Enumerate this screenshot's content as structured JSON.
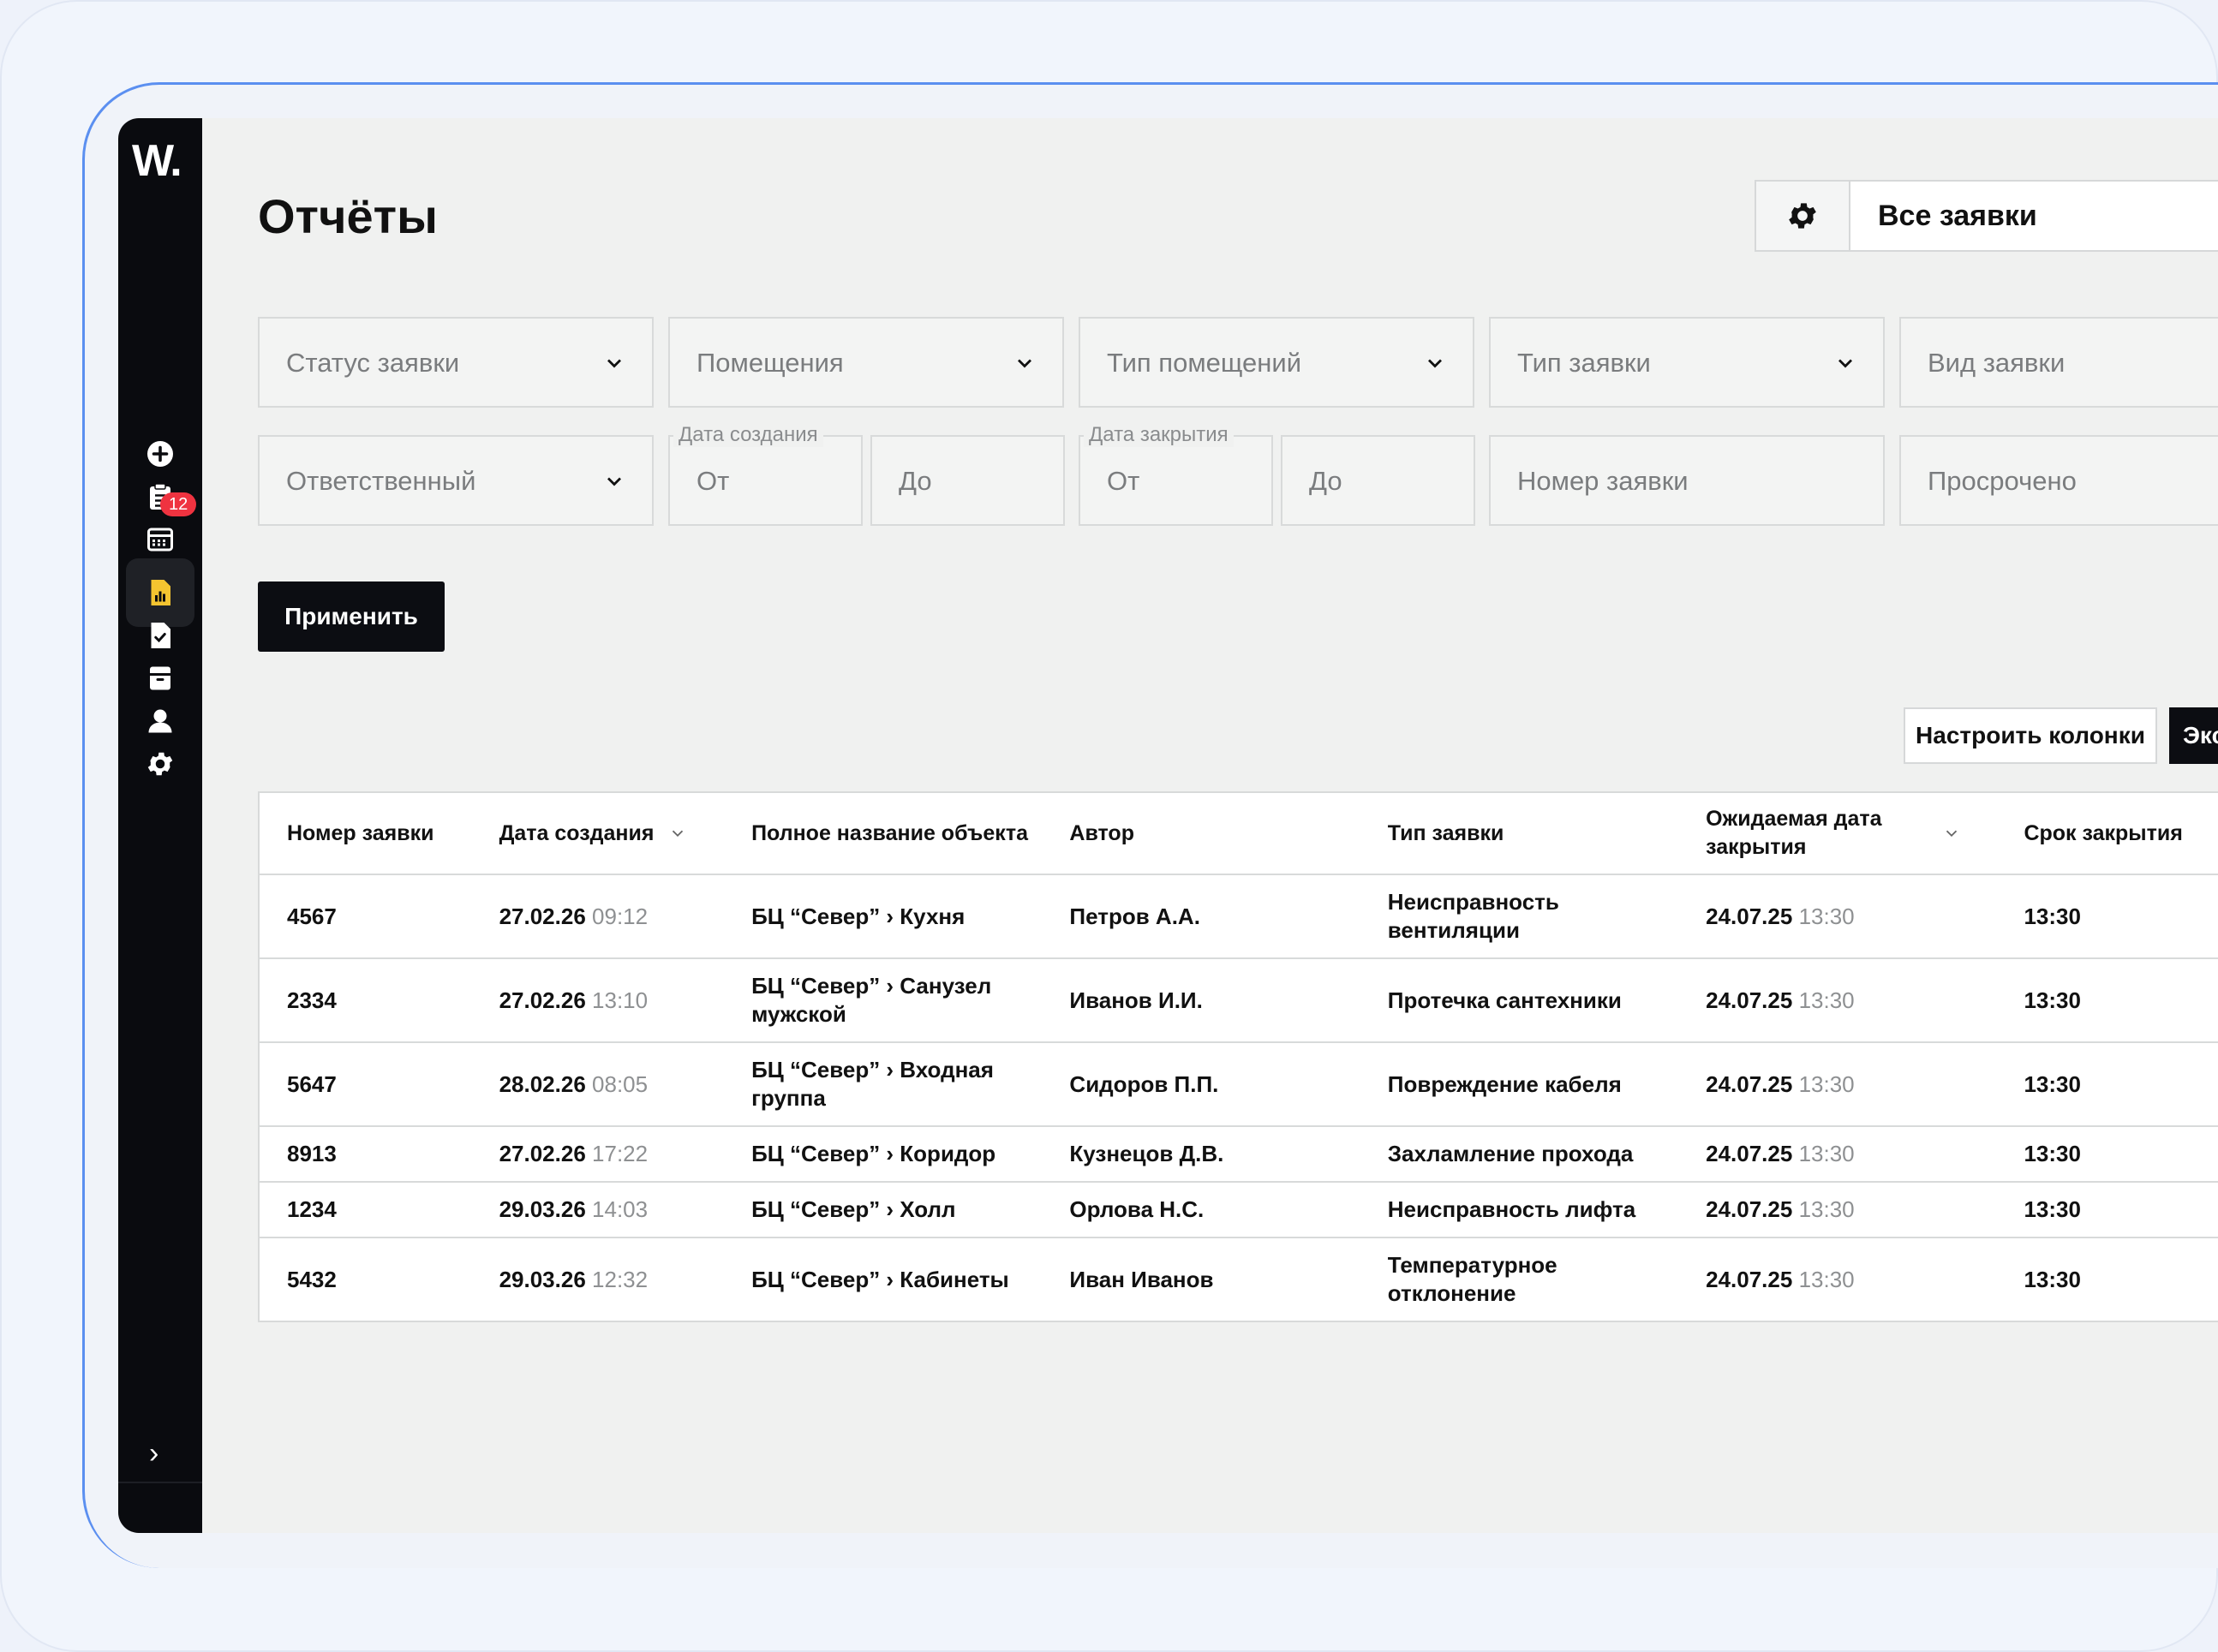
{
  "app": {
    "logo": "W."
  },
  "sidebar": {
    "items": [
      {
        "icon": "plus-circle-icon"
      },
      {
        "icon": "clipboard-icon",
        "badge": "12"
      },
      {
        "icon": "calendar-icon"
      },
      {
        "icon": "report-chart-icon",
        "active": true
      },
      {
        "icon": "file-check-icon"
      },
      {
        "icon": "archive-icon"
      },
      {
        "icon": "user-icon"
      },
      {
        "icon": "gear-icon"
      }
    ],
    "expand_icon": "›"
  },
  "header": {
    "title": "Отчёты",
    "view_label": "Все заявки"
  },
  "filters": {
    "status": "Статус заявки",
    "rooms": "Помещения",
    "room_type": "Тип помещений",
    "request_type": "Тип заявки",
    "request_kind": "Вид заявки",
    "responsible": "Ответственный",
    "created_legend": "Дата создания",
    "created_from": "От",
    "created_to": "До",
    "closed_legend": "Дата закрытия",
    "closed_from": "От",
    "closed_to": "До",
    "number": "Номер заявки",
    "overdue": "Просрочено"
  },
  "actions": {
    "apply": "Применить",
    "columns": "Настроить колонки",
    "export": "Экспорт"
  },
  "table": {
    "headers": {
      "number": "Номер заявки",
      "created": "Дата создания",
      "object": "Полное название объекта",
      "author": "Автор",
      "type": "Тип заявки",
      "expected": "Ожидаемая дата закрытия",
      "deadline": "Срок закрытия"
    },
    "rows": [
      {
        "number": "4567",
        "created_date": "27.02.26",
        "created_time": "09:12",
        "object": "БЦ “Север” › Кухня",
        "author": "Петров А.А.",
        "type": "Неисправность вентиляции",
        "expected_date": "24.07.25",
        "expected_time": "13:30",
        "deadline": "13:30"
      },
      {
        "number": "2334",
        "created_date": "27.02.26",
        "created_time": "13:10",
        "object": "БЦ “Север” › Санузел мужской",
        "author": "Иванов И.И.",
        "type": "Протечка сантехники",
        "expected_date": "24.07.25",
        "expected_time": "13:30",
        "deadline": "13:30"
      },
      {
        "number": "5647",
        "created_date": "28.02.26",
        "created_time": "08:05",
        "object": "БЦ “Север” › Входная группа",
        "author": "Сидоров П.П.",
        "type": "Повреждение кабеля",
        "expected_date": "24.07.25",
        "expected_time": "13:30",
        "deadline": "13:30"
      },
      {
        "number": "8913",
        "created_date": "27.02.26",
        "created_time": "17:22",
        "object": "БЦ “Север” › Коридор",
        "author": "Кузнецов Д.В.",
        "type": "Захламление прохода",
        "expected_date": "24.07.25",
        "expected_time": "13:30",
        "deadline": "13:30"
      },
      {
        "number": "1234",
        "created_date": "29.03.26",
        "created_time": "14:03",
        "object": "БЦ “Север” › Холл",
        "author": "Орлова Н.С.",
        "type": "Неисправность лифта",
        "expected_date": "24.07.25",
        "expected_time": "13:30",
        "deadline": "13:30"
      },
      {
        "number": "5432",
        "created_date": "29.03.26",
        "created_time": "12:32",
        "object": "БЦ “Север” › Кабинеты",
        "author": "Иван Иванов",
        "type": "Температурное отклонение",
        "expected_date": "24.07.25",
        "expected_time": "13:30",
        "deadline": "13:30"
      }
    ]
  },
  "colors": {
    "sidebar_bg": "#0a0b0f",
    "active_icon": "#f4c430",
    "badge": "#ef3340",
    "accent_frame": "#5b8ff0"
  }
}
